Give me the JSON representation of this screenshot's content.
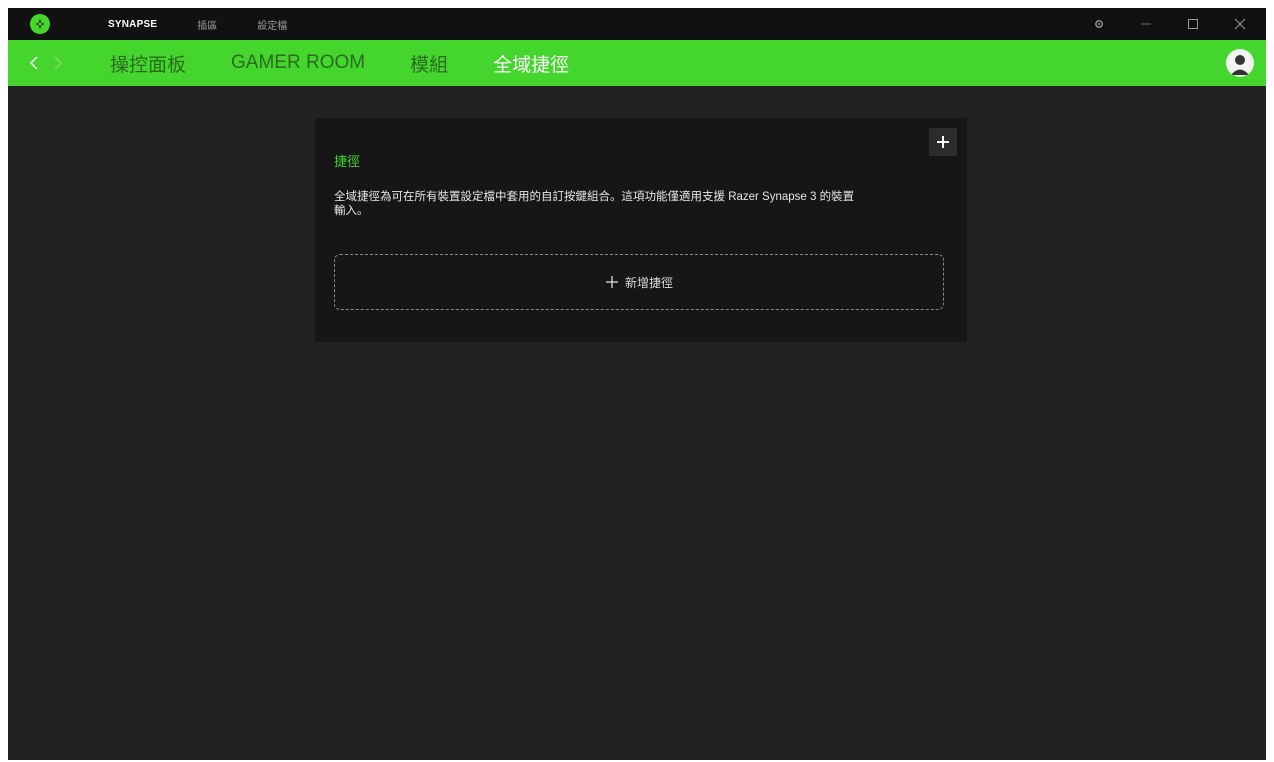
{
  "titlebar": {
    "menu": [
      "SYNAPSE",
      "插區",
      "設定檔"
    ],
    "active_index": 0
  },
  "nav": {
    "tabs": [
      "操控面板",
      "GAMER ROOM",
      "模組",
      "全域捷徑"
    ],
    "active_tab": "全域捷徑"
  },
  "card": {
    "title": "捷徑",
    "description_line1": "全域捷徑為可在所有裝置設定檔中套用的自訂按鍵組合。這項功能僅適用支援 Razer Synapse 3 的裝置",
    "description_line2": "輸入。",
    "add_label": "新增捷徑"
  },
  "icons": {
    "logo": "razer-logo-icon",
    "settings": "gear-icon",
    "minimize": "minimize-icon",
    "maximize": "maximize-icon",
    "close": "close-icon",
    "back": "chevron-left-icon",
    "forward": "chevron-right-icon",
    "user": "user-avatar-icon",
    "plus": "plus-icon"
  },
  "colors": {
    "accent": "#44d62c",
    "background": "#222222",
    "titlebar": "#111111",
    "card": "#161616"
  }
}
